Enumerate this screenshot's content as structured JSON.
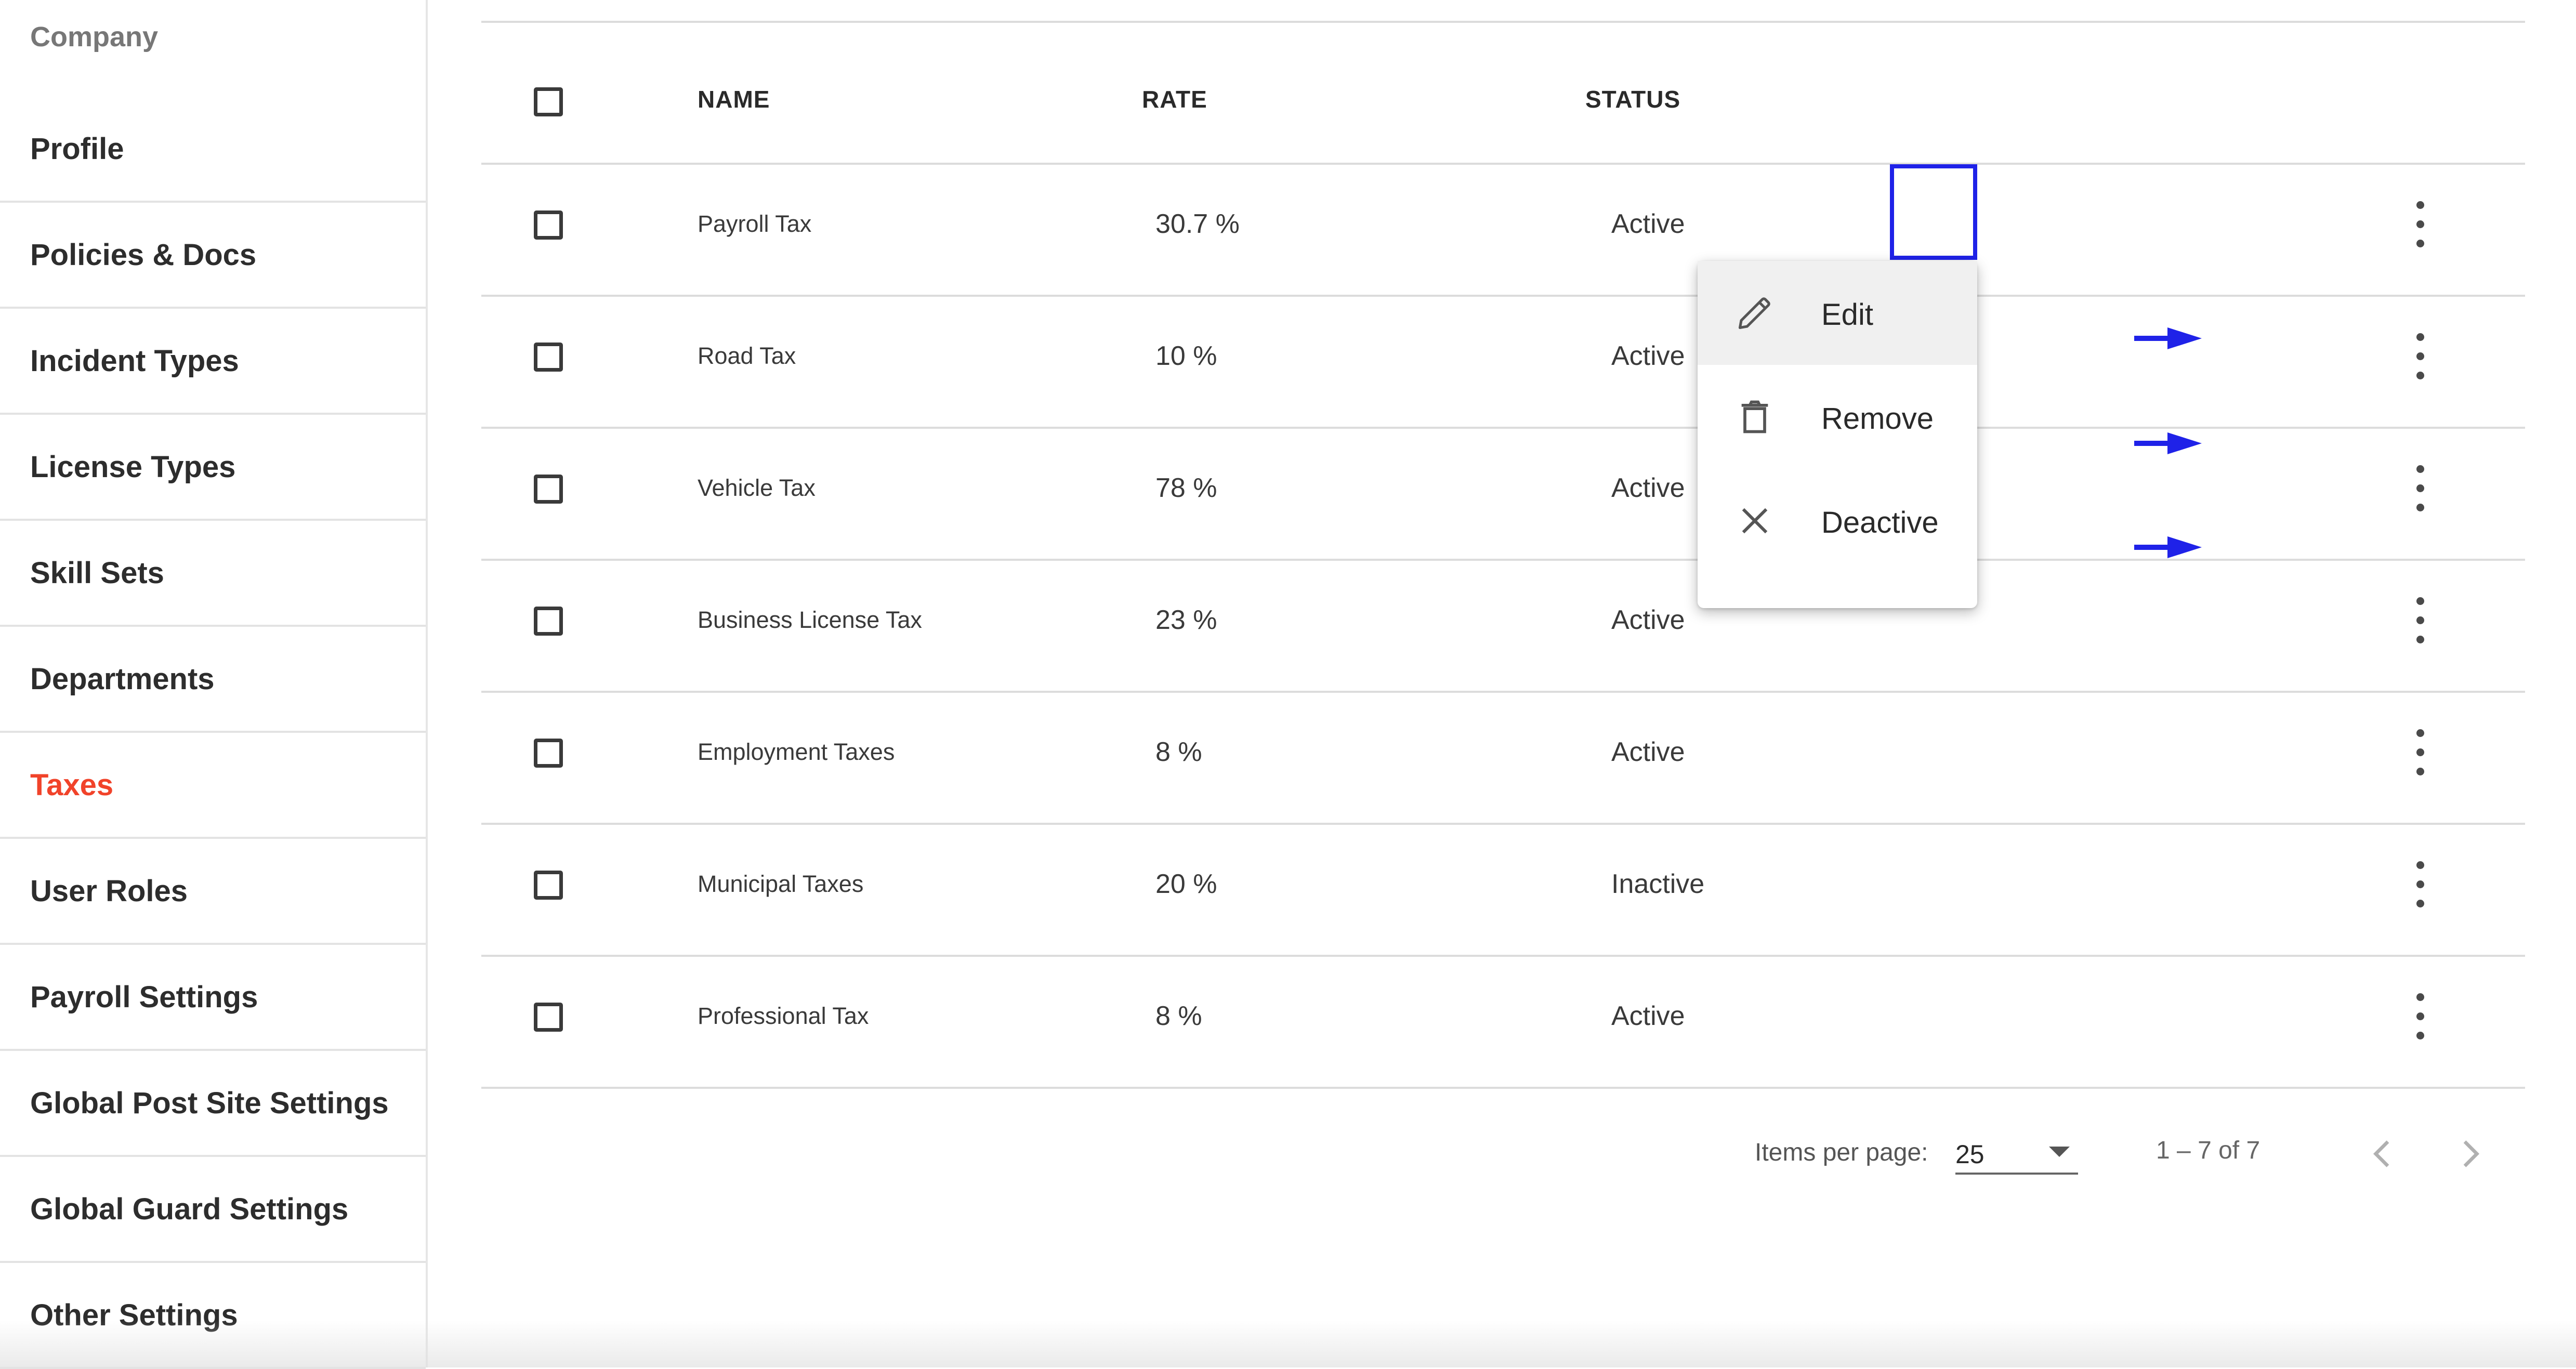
{
  "sidebar": {
    "section_title": "Company",
    "items": [
      {
        "label": "Profile",
        "active": false
      },
      {
        "label": "Policies & Docs",
        "active": false
      },
      {
        "label": "Incident Types",
        "active": false
      },
      {
        "label": "License Types",
        "active": false
      },
      {
        "label": "Skill Sets",
        "active": false
      },
      {
        "label": "Departments",
        "active": false
      },
      {
        "label": "Taxes",
        "active": true
      },
      {
        "label": "User Roles",
        "active": false
      },
      {
        "label": "Payroll Settings",
        "active": false
      },
      {
        "label": "Global Post Site Settings",
        "active": false
      },
      {
        "label": "Global Guard Settings",
        "active": false
      },
      {
        "label": "Other Settings",
        "active": false
      }
    ]
  },
  "table": {
    "headers": {
      "name": "NAME",
      "rate": "RATE",
      "status": "STATUS"
    },
    "rows": [
      {
        "name": "Payroll Tax",
        "rate": "30.7 %",
        "status": "Active"
      },
      {
        "name": "Road Tax",
        "rate": "10 %",
        "status": "Active"
      },
      {
        "name": "Vehicle Tax",
        "rate": "78 %",
        "status": "Active"
      },
      {
        "name": "Business License Tax",
        "rate": "23 %",
        "status": "Active"
      },
      {
        "name": "Employment Taxes",
        "rate": "8 %",
        "status": "Active"
      },
      {
        "name": "Municipal Taxes",
        "rate": "20 %",
        "status": "Inactive"
      },
      {
        "name": "Professional Tax",
        "rate": "8 %",
        "status": "Active"
      }
    ]
  },
  "menu": {
    "items": [
      {
        "label": "Edit",
        "icon": "pencil-icon"
      },
      {
        "label": "Remove",
        "icon": "trash-icon"
      },
      {
        "label": "Deactive",
        "icon": "close-icon"
      }
    ]
  },
  "pagination": {
    "items_per_page_label": "Items per page:",
    "items_per_page_value": "25",
    "range": "1 – 7 of 7"
  },
  "colors": {
    "accent": "#f1432a",
    "highlight": "#1f22e8",
    "arrow": "#1f22e8"
  }
}
